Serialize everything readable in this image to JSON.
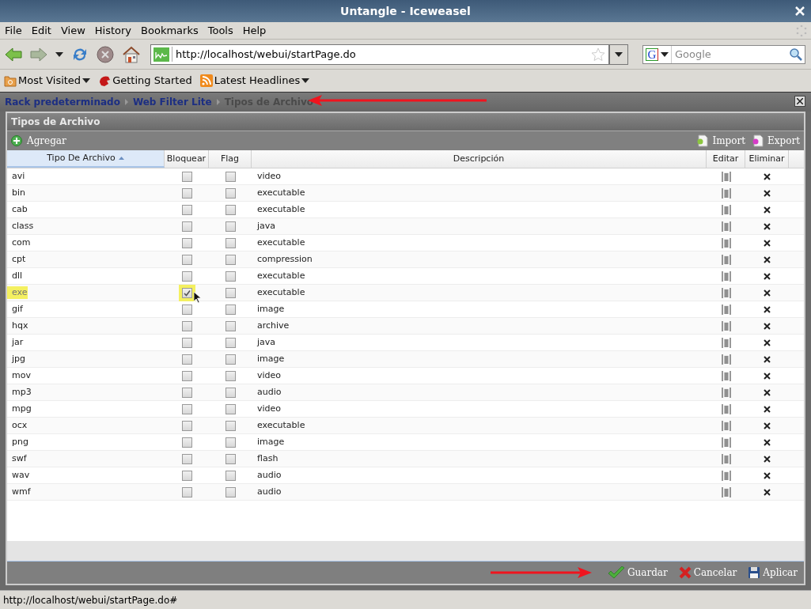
{
  "window": {
    "title": "Untangle - Iceweasel"
  },
  "menu": [
    "File",
    "Edit",
    "View",
    "History",
    "Bookmarks",
    "Tools",
    "Help"
  ],
  "address_bar": {
    "value": "http://localhost/webui/startPage.do"
  },
  "search": {
    "placeholder": "Google",
    "engine": "G"
  },
  "bookmarks": [
    {
      "label": "Most Visited",
      "kind": "folder"
    },
    {
      "label": "Getting Started",
      "kind": "page"
    },
    {
      "label": "Latest Headlines",
      "kind": "feed"
    }
  ],
  "breadcrumb": [
    {
      "label": "Rack predeterminado",
      "current": false
    },
    {
      "label": "Web Filter Lite",
      "current": false
    },
    {
      "label": "Tipos de Archivo",
      "current": true
    }
  ],
  "panel": {
    "title": "Tipos de Archivo",
    "add_button": "Agregar",
    "import_button": "Import",
    "export_button": "Export"
  },
  "table": {
    "columns": [
      {
        "label": "Tipo De Archivo",
        "sorted": true
      },
      {
        "label": "Bloquear",
        "sorted": false
      },
      {
        "label": "Flag",
        "sorted": false
      },
      {
        "label": "Descripción",
        "sorted": false
      },
      {
        "label": "Editar",
        "sorted": false
      },
      {
        "label": "Eliminar",
        "sorted": false
      }
    ],
    "rows": [
      {
        "type": "avi",
        "block": false,
        "flag": false,
        "description": "video",
        "highlighted": false
      },
      {
        "type": "bin",
        "block": false,
        "flag": false,
        "description": "executable",
        "highlighted": false
      },
      {
        "type": "cab",
        "block": false,
        "flag": false,
        "description": "executable",
        "highlighted": false
      },
      {
        "type": "class",
        "block": false,
        "flag": false,
        "description": "java",
        "highlighted": false
      },
      {
        "type": "com",
        "block": false,
        "flag": false,
        "description": "executable",
        "highlighted": false
      },
      {
        "type": "cpt",
        "block": false,
        "flag": false,
        "description": "compression",
        "highlighted": false
      },
      {
        "type": "dll",
        "block": false,
        "flag": false,
        "description": "executable",
        "highlighted": false
      },
      {
        "type": "exe",
        "block": true,
        "flag": false,
        "description": "executable",
        "highlighted": true
      },
      {
        "type": "gif",
        "block": false,
        "flag": false,
        "description": "image",
        "highlighted": false
      },
      {
        "type": "hqx",
        "block": false,
        "flag": false,
        "description": "archive",
        "highlighted": false
      },
      {
        "type": "jar",
        "block": false,
        "flag": false,
        "description": "java",
        "highlighted": false
      },
      {
        "type": "jpg",
        "block": false,
        "flag": false,
        "description": "image",
        "highlighted": false
      },
      {
        "type": "mov",
        "block": false,
        "flag": false,
        "description": "video",
        "highlighted": false
      },
      {
        "type": "mp3",
        "block": false,
        "flag": false,
        "description": "audio",
        "highlighted": false
      },
      {
        "type": "mpg",
        "block": false,
        "flag": false,
        "description": "video",
        "highlighted": false
      },
      {
        "type": "ocx",
        "block": false,
        "flag": false,
        "description": "executable",
        "highlighted": false
      },
      {
        "type": "png",
        "block": false,
        "flag": false,
        "description": "image",
        "highlighted": false
      },
      {
        "type": "swf",
        "block": false,
        "flag": false,
        "description": "flash",
        "highlighted": false
      },
      {
        "type": "wav",
        "block": false,
        "flag": false,
        "description": "audio",
        "highlighted": false
      },
      {
        "type": "wmf",
        "block": false,
        "flag": false,
        "description": "audio",
        "highlighted": false
      }
    ]
  },
  "footer_buttons": [
    {
      "label": "Guardar",
      "kind": "save"
    },
    {
      "label": "Cancelar",
      "kind": "cancel"
    },
    {
      "label": "Aplicar",
      "kind": "apply"
    }
  ],
  "status_bar": "http://localhost/webui/startPage.do#"
}
